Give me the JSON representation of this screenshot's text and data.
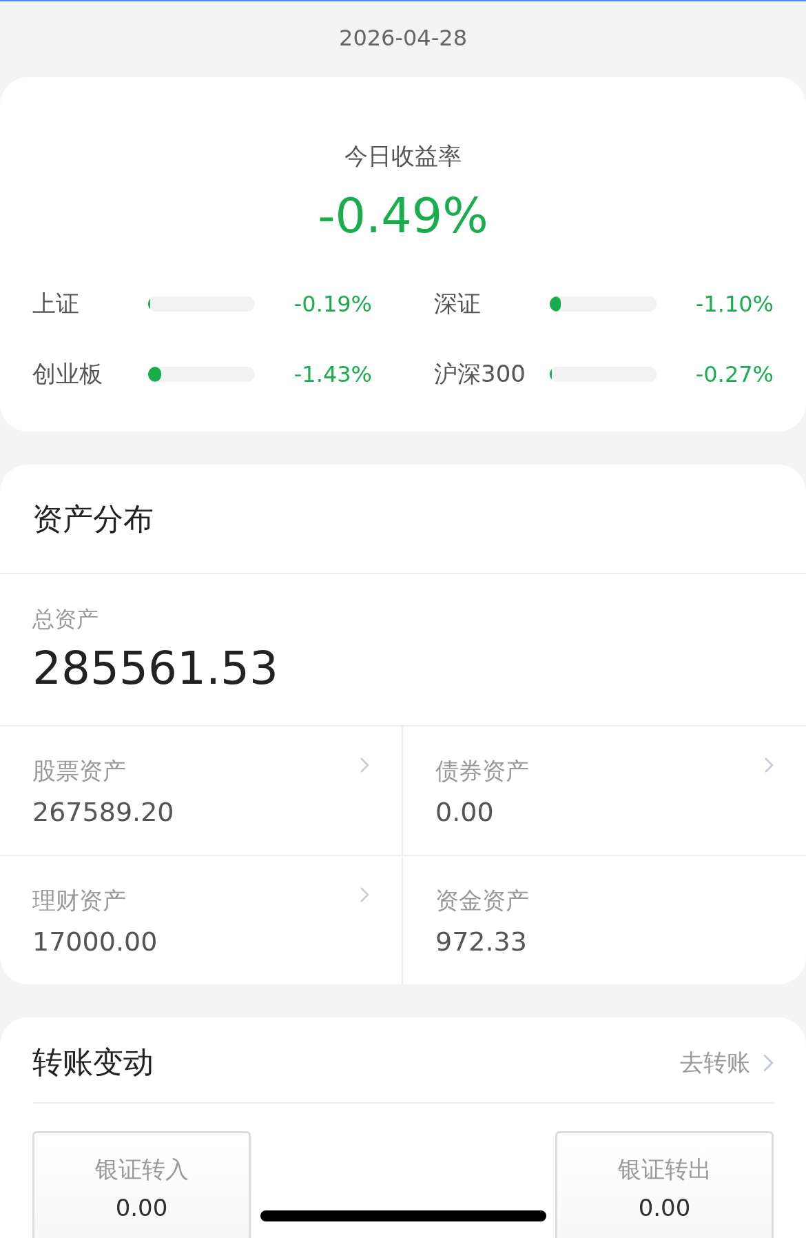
{
  "date": "2026-04-28",
  "today": {
    "title": "今日收益率",
    "rate": "-0.49%"
  },
  "indices": [
    {
      "name": "上证",
      "level": 0.02,
      "change": "-0.19%"
    },
    {
      "name": "深证",
      "level": 0.1,
      "change": "-1.10%"
    },
    {
      "name": "创业板",
      "level": 0.12,
      "change": "-1.43%"
    },
    {
      "name": "沪深300",
      "level": 0.02,
      "change": "-0.27%"
    }
  ],
  "assets": {
    "title": "资产分布",
    "total_label": "总资产",
    "total": "285561.53",
    "items": [
      {
        "label": "股票资产",
        "value": "267589.20",
        "has_arrow": true
      },
      {
        "label": "债券资产",
        "value": "0.00",
        "has_arrow": true
      },
      {
        "label": "理财资产",
        "value": "17000.00",
        "has_arrow": true
      },
      {
        "label": "资金资产",
        "value": "972.33",
        "has_arrow": false
      }
    ]
  },
  "transfers": {
    "title": "转账变动",
    "link": "去转账",
    "boxes": [
      {
        "label": "银证转入",
        "value": "0.00"
      },
      {
        "label": "银证转出",
        "value": "0.00"
      }
    ]
  }
}
